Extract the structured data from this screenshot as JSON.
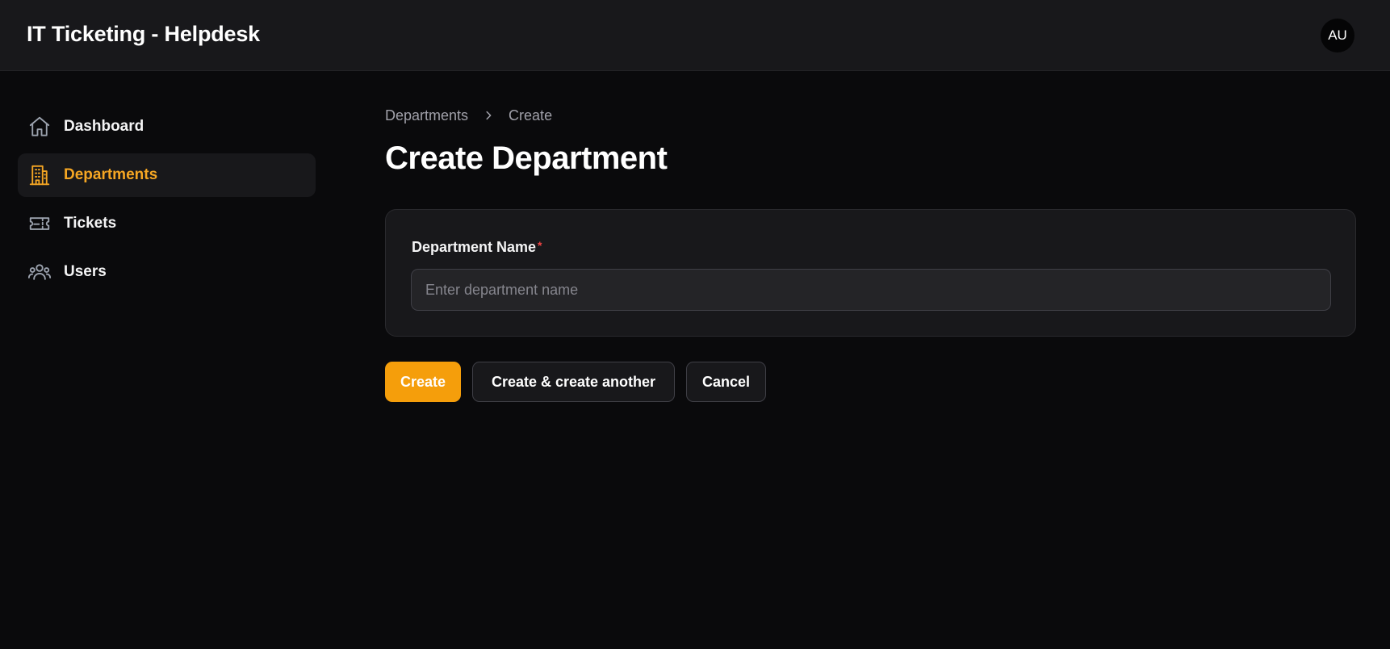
{
  "header": {
    "title": "IT Ticketing - Helpdesk",
    "avatar_initials": "AU"
  },
  "sidebar": {
    "items": [
      {
        "label": "Dashboard",
        "icon": "home-icon",
        "active": false
      },
      {
        "label": "Departments",
        "icon": "building-icon",
        "active": true
      },
      {
        "label": "Tickets",
        "icon": "ticket-icon",
        "active": false
      },
      {
        "label": "Users",
        "icon": "users-icon",
        "active": false
      }
    ]
  },
  "breadcrumb": {
    "items": [
      "Departments",
      "Create"
    ]
  },
  "page": {
    "title": "Create Department"
  },
  "form": {
    "department_name": {
      "label": "Department Name",
      "required_mark": "*",
      "value": "",
      "placeholder": "Enter department name"
    }
  },
  "actions": {
    "create_label": "Create",
    "create_another_label": "Create & create another",
    "cancel_label": "Cancel"
  },
  "colors": {
    "accent": "#f59e0b",
    "active_nav_text": "#f5a623",
    "background": "#0a0a0c",
    "surface": "#18181b",
    "required": "#ef4444"
  }
}
